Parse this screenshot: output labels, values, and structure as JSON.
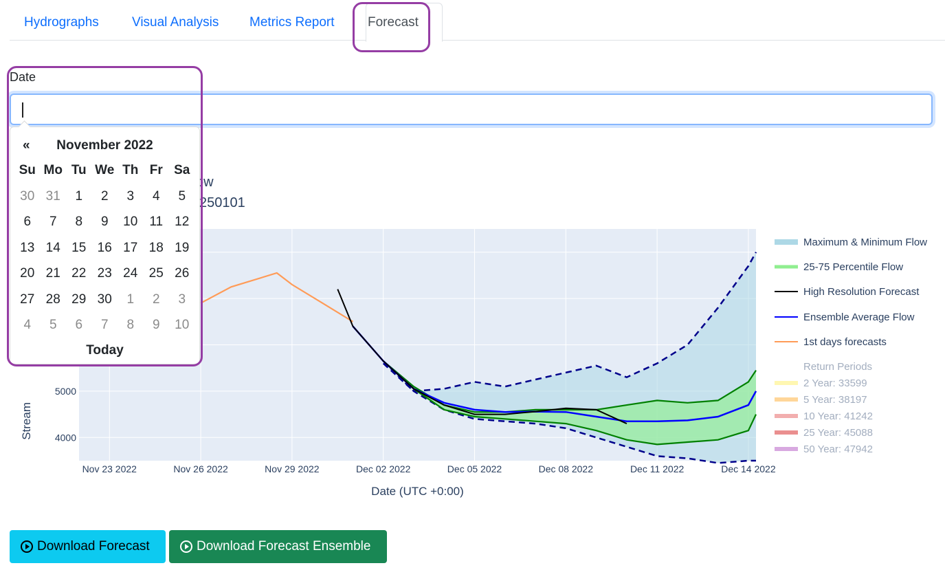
{
  "tabs": [
    {
      "label": "Hydrographs"
    },
    {
      "label": "Visual Analysis"
    },
    {
      "label": "Metrics Report"
    },
    {
      "label": "Forecast"
    }
  ],
  "date_field": {
    "label": "Date",
    "value": ""
  },
  "calendar": {
    "prev": "«",
    "title": "November 2022",
    "weekdays": [
      "Su",
      "Mo",
      "Tu",
      "We",
      "Th",
      "Fr",
      "Sa"
    ],
    "days": [
      "30",
      "31",
      "1",
      "2",
      "3",
      "4",
      "5",
      "6",
      "7",
      "8",
      "9",
      "10",
      "11",
      "12",
      "13",
      "14",
      "15",
      "16",
      "17",
      "18",
      "19",
      "20",
      "21",
      "22",
      "23",
      "24",
      "25",
      "26",
      "27",
      "28",
      "29",
      "30",
      "1",
      "2",
      "3",
      "4",
      "5",
      "6",
      "7",
      "8",
      "9",
      "10"
    ],
    "today_label": "Today"
  },
  "plot": {
    "title_line1": "ow",
    "title_line2": "250101"
  },
  "buttons": {
    "download_forecast": "Download Forecast",
    "download_ensemble": "Download Forecast Ensemble"
  },
  "chart_data": {
    "type": "line",
    "xlabel": "Date (UTC +0:00)",
    "ylabel": "Stream",
    "x_ticks": [
      "Nov 23 2022",
      "Nov 26 2022",
      "Nov 29 2022",
      "Dec 02 2022",
      "Dec 05 2022",
      "Dec 08 2022",
      "Dec 11 2022",
      "Dec 14 2022"
    ],
    "y_ticks": [
      4000,
      5000
    ],
    "xlim": [
      "2022-11-22",
      "2022-12-14T06:00"
    ],
    "ylim": [
      3500,
      8500
    ],
    "legend_placement": "right",
    "legend": [
      "Maximum & Minimum Flow",
      "25-75 Percentile Flow",
      "High Resolution Forecast",
      "Ensemble Average Flow",
      "1st days forecasts"
    ],
    "return_periods_title": "Return Periods",
    "return_periods": [
      {
        "label": "2 Year: 33599",
        "color": "#fff59d"
      },
      {
        "label": "5 Year: 38197",
        "color": "#ffcc80"
      },
      {
        "label": "10 Year: 41242",
        "color": "#ef9a9a"
      },
      {
        "label": "25 Year: 45088",
        "color": "#e57373"
      },
      {
        "label": "50 Year: 47942",
        "color": "#ce93d8"
      }
    ],
    "colors": {
      "first_days": "#ff9b57",
      "high_res": "#000000",
      "ensemble_avg": "#0000ff",
      "percentile": "#008000",
      "max_min": "#00008b",
      "max_min_fill": "#add8e6",
      "percentile_fill": "#90ee90"
    },
    "series": [
      {
        "name": "1st days forecasts",
        "x": [
          "2022-11-26",
          "2022-11-27",
          "2022-11-28T12:00",
          "2022-11-29",
          "2022-11-30",
          "2022-12-01"
        ],
        "y": [
          6900,
          7250,
          7550,
          7300,
          6900,
          6500
        ]
      },
      {
        "name": "High Resolution Forecast",
        "x": [
          "2022-11-30T12:00",
          "2022-12-01",
          "2022-12-02",
          "2022-12-03",
          "2022-12-04",
          "2022-12-05",
          "2022-12-06",
          "2022-12-07",
          "2022-12-08",
          "2022-12-09",
          "2022-12-10"
        ],
        "y": [
          7200,
          6400,
          5650,
          5050,
          4700,
          4500,
          4500,
          4560,
          4630,
          4600,
          4300
        ]
      },
      {
        "name": "Ensemble Average Flow",
        "x": [
          "2022-12-01",
          "2022-12-02",
          "2022-12-03",
          "2022-12-04",
          "2022-12-05",
          "2022-12-06",
          "2022-12-07",
          "2022-12-08",
          "2022-12-09",
          "2022-12-10",
          "2022-12-11",
          "2022-12-12",
          "2022-12-13",
          "2022-12-14",
          "2022-12-14T06:00"
        ],
        "y": [
          6400,
          5650,
          5050,
          4750,
          4600,
          4550,
          4560,
          4550,
          4450,
          4350,
          4350,
          4370,
          4450,
          4700,
          5000
        ]
      },
      {
        "name": "Maximum Flow",
        "x": [
          "2022-12-02",
          "2022-12-03",
          "2022-12-04",
          "2022-12-05",
          "2022-12-06",
          "2022-12-07",
          "2022-12-08",
          "2022-12-09",
          "2022-12-10",
          "2022-12-11",
          "2022-12-12",
          "2022-12-13",
          "2022-12-14",
          "2022-12-14T06:00"
        ],
        "y": [
          5600,
          5000,
          5050,
          5200,
          5100,
          5250,
          5400,
          5550,
          5300,
          5600,
          6000,
          6800,
          7700,
          8000
        ]
      },
      {
        "name": "Minimum Flow",
        "x": [
          "2022-12-02",
          "2022-12-03",
          "2022-12-04",
          "2022-12-05",
          "2022-12-06",
          "2022-12-07",
          "2022-12-08",
          "2022-12-09",
          "2022-12-10",
          "2022-12-11",
          "2022-12-12",
          "2022-12-13",
          "2022-12-14",
          "2022-12-14T06:00"
        ],
        "y": [
          5650,
          5000,
          4600,
          4400,
          4350,
          4300,
          4200,
          4000,
          3800,
          3600,
          3550,
          3450,
          3500,
          3500
        ]
      },
      {
        "name": "75 Percentile Flow",
        "x": [
          "2022-12-02",
          "2022-12-03",
          "2022-12-04",
          "2022-12-05",
          "2022-12-06",
          "2022-12-07",
          "2022-12-08",
          "2022-12-09",
          "2022-12-10",
          "2022-12-11",
          "2022-12-12",
          "2022-12-13",
          "2022-12-14",
          "2022-12-14T06:00"
        ],
        "y": [
          5650,
          5100,
          4700,
          4550,
          4550,
          4600,
          4600,
          4600,
          4700,
          4800,
          4750,
          4800,
          5200,
          5450
        ]
      },
      {
        "name": "25 Percentile Flow",
        "x": [
          "2022-12-02",
          "2022-12-03",
          "2022-12-04",
          "2022-12-05",
          "2022-12-06",
          "2022-12-07",
          "2022-12-08",
          "2022-12-09",
          "2022-12-10",
          "2022-12-11",
          "2022-12-12",
          "2022-12-13",
          "2022-12-14",
          "2022-12-14T06:00"
        ],
        "y": [
          5650,
          5050,
          4600,
          4450,
          4400,
          4350,
          4300,
          4150,
          3950,
          3850,
          3900,
          3950,
          4150,
          4500
        ]
      }
    ]
  }
}
